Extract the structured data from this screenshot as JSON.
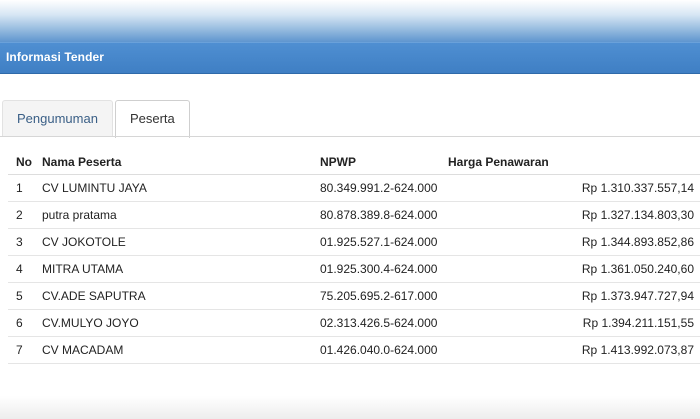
{
  "panel": {
    "title": "Informasi Tender"
  },
  "tabs": [
    {
      "label": "Pengumuman",
      "active": false
    },
    {
      "label": "Peserta",
      "active": true
    }
  ],
  "table": {
    "headers": {
      "no": "No",
      "name": "Nama Peserta",
      "npwp": "NPWP",
      "harga": "Harga Penawaran"
    },
    "rows": [
      {
        "no": "1",
        "name": "CV LUMINTU JAYA",
        "npwp": "80.349.991.2-624.000",
        "harga": "Rp 1.310.337.557,14"
      },
      {
        "no": "2",
        "name": "putra pratama",
        "npwp": "80.878.389.8-624.000",
        "harga": "Rp 1.327.134.803,30"
      },
      {
        "no": "3",
        "name": "CV JOKOTOLE",
        "npwp": "01.925.527.1-624.000",
        "harga": "Rp 1.344.893.852,86"
      },
      {
        "no": "4",
        "name": "MITRA UTAMA",
        "npwp": "01.925.300.4-624.000",
        "harga": "Rp 1.361.050.240,60"
      },
      {
        "no": "5",
        "name": "CV.ADE SAPUTRA",
        "npwp": "75.205.695.2-617.000",
        "harga": "Rp 1.373.947.727,94"
      },
      {
        "no": "6",
        "name": "CV.MULYO JOYO",
        "npwp": "02.313.426.5-624.000",
        "harga": "Rp 1.394.211.151,55"
      },
      {
        "no": "7",
        "name": "CV MACADAM",
        "npwp": "01.426.040.0-624.000",
        "harga": "Rp 1.413.992.073,87"
      }
    ]
  },
  "colors": {
    "header_blue": "#3f7fc4",
    "tab_text_inactive": "#3a5f86"
  }
}
